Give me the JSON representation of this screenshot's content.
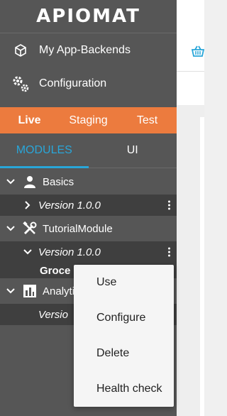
{
  "logo": {
    "text": "APIOMAT"
  },
  "nav": [
    {
      "label": "My App-Backends",
      "icon": "cube-icon"
    },
    {
      "label": "Configuration",
      "icon": "gears-icon"
    }
  ],
  "environments": {
    "tabs": [
      "Live",
      "Staging",
      "Test"
    ],
    "active": "Live",
    "accent_color": "#ec7b3e"
  },
  "sub_tabs": {
    "tabs": [
      "MODULES",
      "UI"
    ],
    "active": "MODULES",
    "accent_color": "#29a6d9"
  },
  "tree": {
    "basics": {
      "label": "Basics",
      "icon": "person-icon",
      "version": "Version 1.0.0"
    },
    "tutorial": {
      "label": "TutorialModule",
      "icon": "tools-icon",
      "version": "Version 1.0.0",
      "leaf": "Groce"
    },
    "analytics": {
      "label": "Analyti",
      "icon": "bar-chart-icon",
      "version": "Versio"
    }
  },
  "context_menu": {
    "items": [
      "Use",
      "Configure",
      "Delete",
      "Health check"
    ]
  }
}
